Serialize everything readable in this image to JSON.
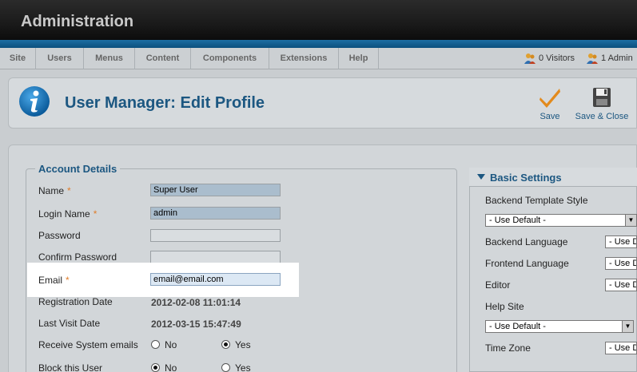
{
  "header": {
    "title": "Administration"
  },
  "menu": {
    "items": [
      {
        "label": "Site"
      },
      {
        "label": "Users"
      },
      {
        "label": "Menus"
      },
      {
        "label": "Content"
      },
      {
        "label": "Components"
      },
      {
        "label": "Extensions"
      },
      {
        "label": "Help"
      }
    ],
    "visitors": "0 Visitors",
    "admins": "1 Admin"
  },
  "toolbar": {
    "title": "User Manager: Edit Profile",
    "save_label": "Save",
    "save_close_label": "Save & Close"
  },
  "account": {
    "legend": "Account Details",
    "name_label": "Name",
    "name_value": "Super User",
    "login_label": "Login Name",
    "login_value": "admin",
    "password_label": "Password",
    "password_value": "",
    "confirm_label": "Confirm Password",
    "confirm_value": "",
    "email_label": "Email",
    "email_value": "email@email.com",
    "required_mark": "*",
    "reg_date_label": "Registration Date",
    "reg_date_value": "2012-02-08 11:01:14",
    "last_visit_label": "Last Visit Date",
    "last_visit_value": "2012-03-15 15:47:49",
    "receive_label": "Receive System emails",
    "receive_selected": "Yes",
    "block_label": "Block this User",
    "block_selected": "No",
    "no_label": "No",
    "yes_label": "Yes"
  },
  "basic_settings": {
    "title": "Basic Settings",
    "backend_template_label": "Backend Template Style",
    "backend_template_value": "- Use Default -",
    "backend_language_label": "Backend Language",
    "backend_language_value": "- Use D",
    "frontend_language_label": "Frontend Language",
    "frontend_language_value": "- Use D",
    "editor_label": "Editor",
    "editor_value": "- Use D",
    "help_site_label": "Help Site",
    "help_site_value": "- Use Default -",
    "timezone_label": "Time Zone",
    "timezone_value": "- Use D"
  },
  "colors": {
    "header_bg": "#1a1a1a",
    "accent_blue": "#1c5781",
    "required": "#e07d2a"
  }
}
